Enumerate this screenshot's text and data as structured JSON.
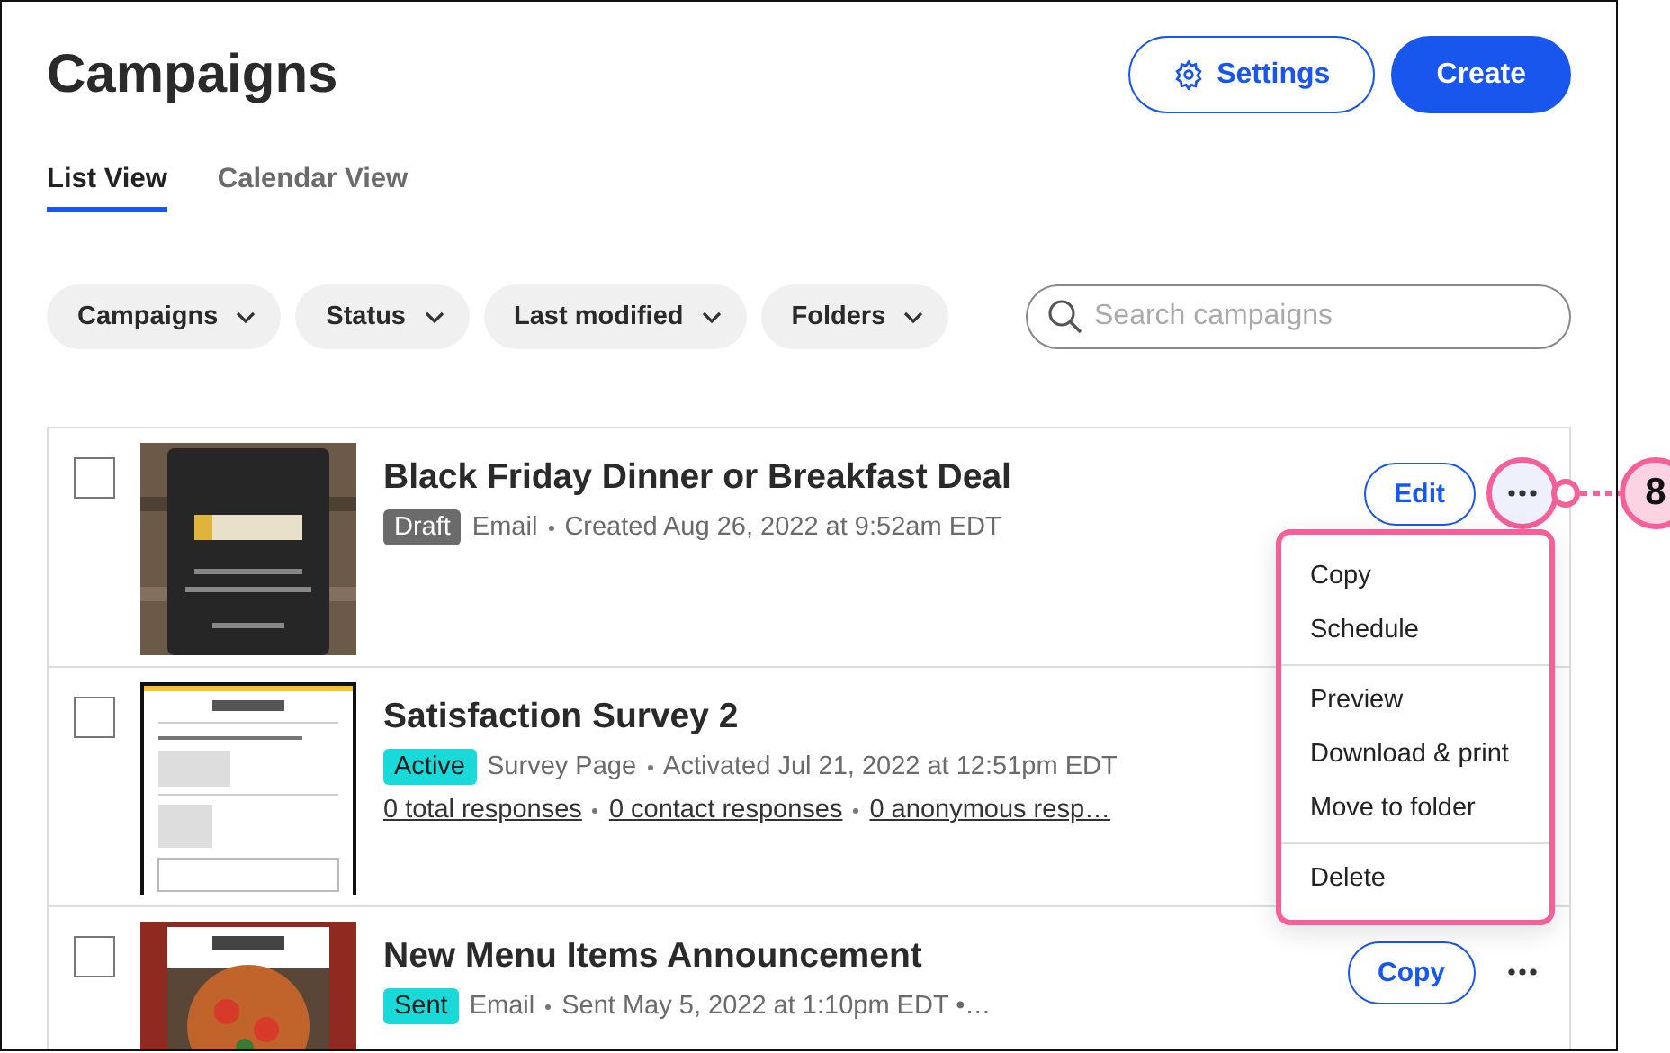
{
  "header": {
    "title": "Campaigns",
    "buttons": [
      {
        "label": "Settings",
        "kind": "outline"
      },
      {
        "label": "Create",
        "kind": "primary"
      }
    ]
  },
  "tabs": [
    {
      "label": "List View",
      "selected": true
    },
    {
      "label": "Calendar View",
      "selected": false
    }
  ],
  "filters": [
    "Campaigns",
    "Status",
    "Last modified",
    "Folders"
  ],
  "search": {
    "placeholder": "Search campaigns"
  },
  "campaigns": [
    {
      "title": "Black Friday Dinner or Breakfast Deal",
      "status": "Draft",
      "color": "#6b6b6b",
      "type": "Email",
      "detail": "Created Aug 26, 2022 at 9:52am EDT",
      "checked": false,
      "action": "Edit",
      "highlighted": true
    },
    {
      "title": "Satisfaction Survey 2",
      "status": "Active",
      "color": "#1ad9d9",
      "type": "Survey Page",
      "detail": "Activated Jul 21, 2022 at 12:51pm EDT",
      "checked": false,
      "links": [
        "0 total responses",
        "0 contact responses",
        "0 anonymous resp…"
      ]
    },
    {
      "title": "New Menu Items Announcement",
      "status": "Sent",
      "color": "#1ad9d9",
      "type": "Email",
      "detail": "Sent May 5, 2022 at 1:10pm EDT •…",
      "checked": false,
      "action": "Copy",
      "highlighted": false
    }
  ],
  "menu": {
    "sections": [
      [
        "Copy",
        "Schedule"
      ],
      [
        "Preview",
        "Download & print",
        "Move to folder"
      ],
      [
        "Delete"
      ]
    ]
  },
  "callout": {
    "label": "8"
  }
}
